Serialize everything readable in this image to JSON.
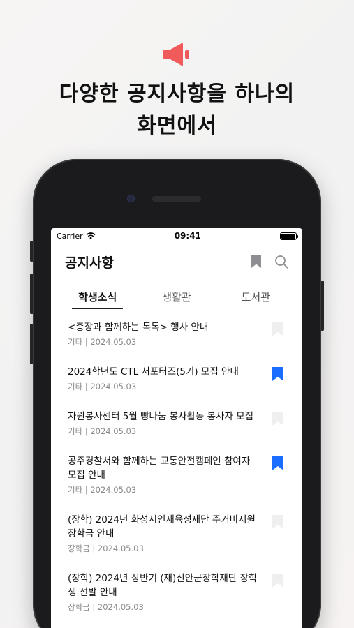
{
  "headline": {
    "line1": "다양한 공지사항을 하나의",
    "line2": "화면에서"
  },
  "colors": {
    "accent": "#1a6dff",
    "megaphone": "#f05a5a",
    "bookmark_off": "#efefef"
  },
  "status": {
    "carrier": "Carrier",
    "time": "09:41"
  },
  "appbar": {
    "title": "공지사항",
    "bookmark_icon": "bookmark-icon",
    "search_icon": "search-icon"
  },
  "tabs": [
    {
      "label": "학생소식",
      "active": true
    },
    {
      "label": "생활관",
      "active": false
    },
    {
      "label": "도서관",
      "active": false
    }
  ],
  "notices": [
    {
      "title": "<총장과 함께하는 톡톡> 행사 안내",
      "meta": "기타 | 2024.05.03",
      "bookmarked": false
    },
    {
      "title": "2024학년도 CTL 서포터즈(5기) 모집 안내",
      "meta": "기타 | 2024.05.03",
      "bookmarked": true
    },
    {
      "title": "자원봉사센터 5월 빵나눔 봉사활동 봉사자 모집",
      "meta": "기타 | 2024.05.03",
      "bookmarked": false
    },
    {
      "title": "공주경찰서와 함께하는 교통안전캠페인 참여자 모집 안내",
      "meta": "기타 | 2024.05.03",
      "bookmarked": true
    },
    {
      "title": "(장학) 2024년 화성시인재육성재단 주거비지원 장학금 안내",
      "meta": "장학금 | 2024.05.03",
      "bookmarked": false
    },
    {
      "title": "(장학) 2024년 상반기 (재)신안군장학재단 장학생 선발 안내",
      "meta": "장학금 | 2024.05.03",
      "bookmarked": false
    }
  ]
}
